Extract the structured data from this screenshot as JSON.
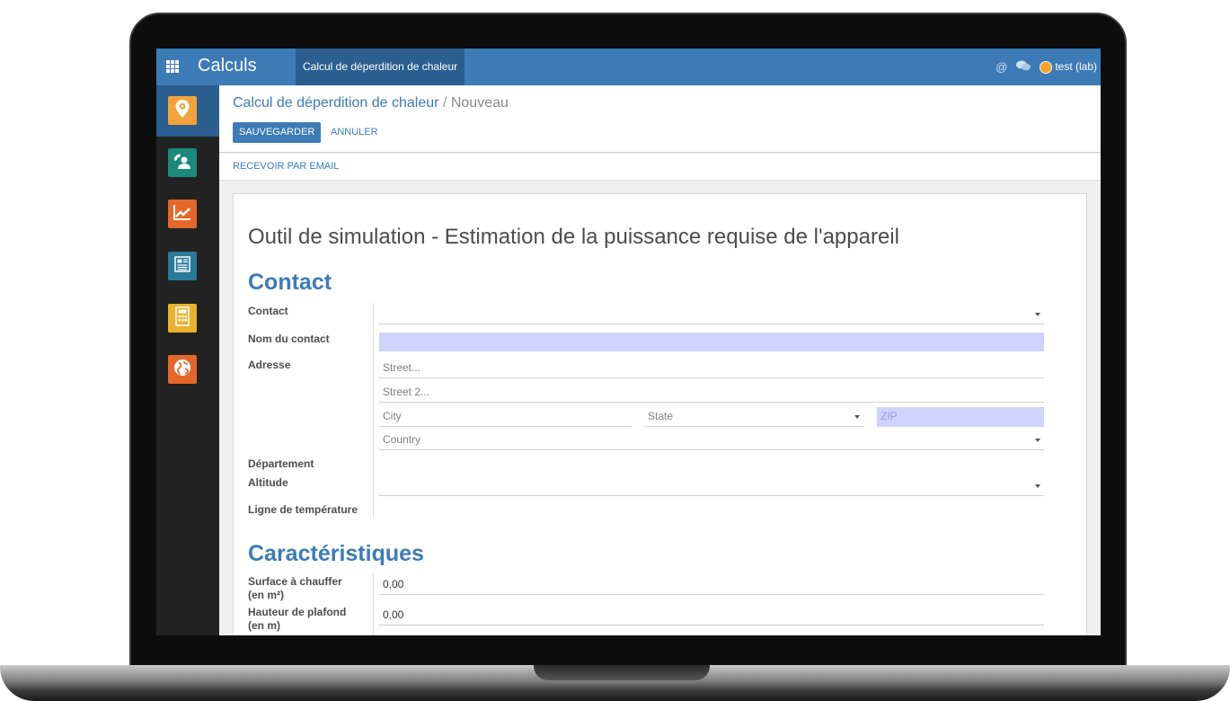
{
  "navbar": {
    "brand": "Calculs",
    "active_menu": "Calcul de déperdition de chaleur",
    "user": "test (lab)",
    "icons": [
      "apps-icon",
      "at-icon",
      "chat-icon",
      "user-avatar-icon"
    ],
    "color": "#3d7bb6"
  },
  "sidebar": {
    "items": [
      {
        "icon": "map-pin-settings-icon",
        "color": "#f2a33a",
        "active": true
      },
      {
        "icon": "contacts-icon",
        "color": "#1a8a7a"
      },
      {
        "icon": "chart-line-icon",
        "color": "#e4682a"
      },
      {
        "icon": "newspaper-icon",
        "color": "#2a7a9a"
      },
      {
        "icon": "calculator-icon",
        "color": "#e8b22a"
      },
      {
        "icon": "globe-icon",
        "color": "#e4682a"
      }
    ]
  },
  "control": {
    "breadcrumb_parent": "Calcul de déperdition de chaleur",
    "breadcrumb_sep": "/",
    "breadcrumb_current": "Nouveau",
    "save_label": "SAUVEGARDER",
    "cancel_label": "ANNULER",
    "email_label": "RECEVOIR PAR EMAIL"
  },
  "form": {
    "title": "Outil de simulation - Estimation de la puissance requise de l'appareil",
    "section_contact": "Contact",
    "labels": {
      "contact": "Contact",
      "nom_contact": "Nom du contact",
      "adresse": "Adresse",
      "departement": "Département",
      "altitude": "Altitude",
      "ligne_temp": "Ligne de température",
      "surface_line1": "Surface à chauffer",
      "surface_line2": "(en m²)",
      "hauteur_line1": "Hauteur de plafond",
      "hauteur_line2": "(en m)"
    },
    "placeholders": {
      "street": "Street...",
      "street2": "Street 2...",
      "city": "City",
      "state": "State",
      "zip": "ZIP",
      "country": "Country"
    },
    "section_caracteristiques": "Caractéristiques",
    "values": {
      "surface": "0,00",
      "hauteur": "0,00"
    },
    "required_color": "#d2d2ff"
  }
}
